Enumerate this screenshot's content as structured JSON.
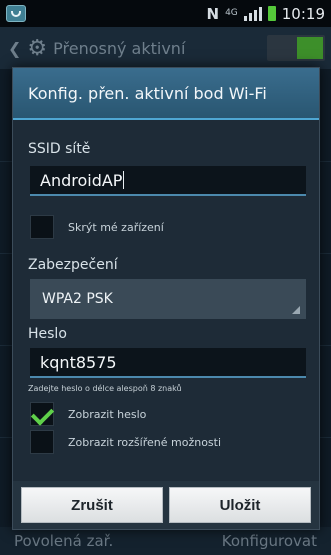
{
  "status_bar": {
    "time": "10:19",
    "network_letter": "N",
    "network_type": "4G",
    "battery_color": "#55c83a"
  },
  "background_app": {
    "title": "Přenosný aktivní",
    "bottom_left": "Povolená zař.",
    "bottom_right": "Konfigurovat"
  },
  "dialog": {
    "title": "Konfig. přen. aktivní bod Wi-Fi",
    "ssid_label": "SSID sítě",
    "ssid_value": "AndroidAP",
    "hide_device_label": "Skrýt mé zařízení",
    "hide_device_checked": false,
    "security_label": "Zabezpečení",
    "security_value": "WPA2 PSK",
    "password_label": "Heslo",
    "password_value": "kqnt8575",
    "password_hint": "Zadejte heslo o délce alespoň 8 znaků",
    "show_password_label": "Zobrazit heslo",
    "show_password_checked": true,
    "show_advanced_label": "Zobrazit rozšířené možnosti",
    "show_advanced_checked": false,
    "cancel_label": "Zrušit",
    "save_label": "Uložit"
  },
  "colors": {
    "accent": "#4fa7d3",
    "title_bar": "#2e5e7e",
    "check": "#5fd04a"
  }
}
